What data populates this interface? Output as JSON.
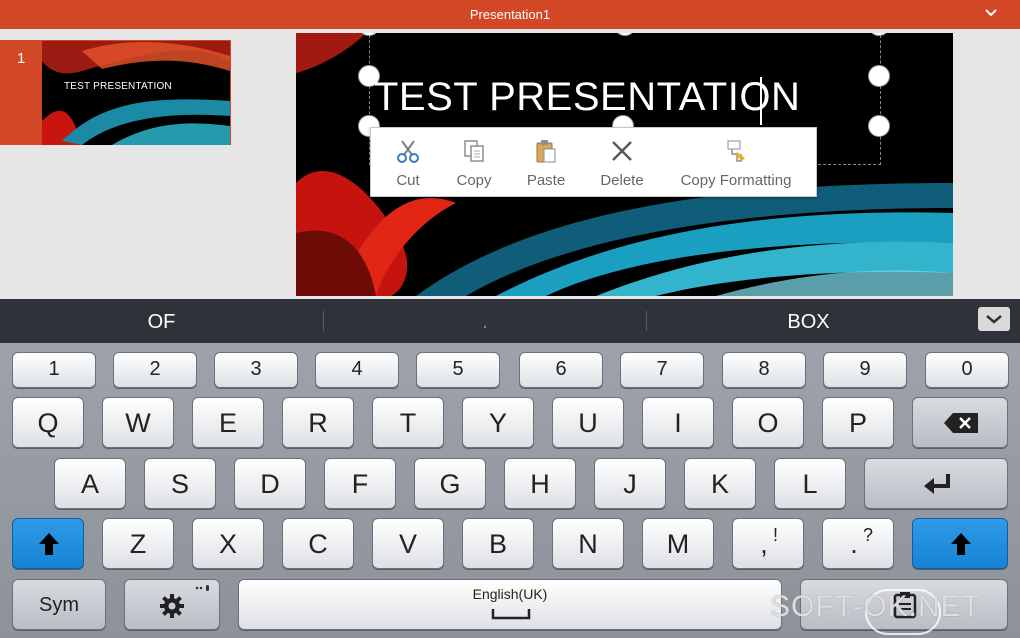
{
  "titlebar": {
    "title": "Presentation1"
  },
  "slides_panel": {
    "slide_number": "1",
    "thumb_title": "TEST PRESENTATION"
  },
  "slide": {
    "title": "TEST PRESENTATION"
  },
  "context_menu": {
    "items": [
      {
        "label": "Cut",
        "icon": "scissors-icon"
      },
      {
        "label": "Copy",
        "icon": "copy-icon"
      },
      {
        "label": "Paste",
        "icon": "paste-icon"
      },
      {
        "label": "Delete",
        "icon": "delete-x-icon"
      },
      {
        "label": "Copy Formatting",
        "icon": "format-painter-icon"
      }
    ]
  },
  "suggestions": {
    "left": "OF",
    "middle": ".",
    "right": "BOX"
  },
  "keyboard": {
    "numbers": [
      "1",
      "2",
      "3",
      "4",
      "5",
      "6",
      "7",
      "8",
      "9",
      "0"
    ],
    "row1": [
      "Q",
      "W",
      "E",
      "R",
      "T",
      "Y",
      "U",
      "I",
      "O",
      "P"
    ],
    "row2": [
      "A",
      "S",
      "D",
      "F",
      "G",
      "H",
      "J",
      "K",
      "L"
    ],
    "row3": [
      "Z",
      "X",
      "C",
      "V",
      "B",
      "N",
      "M"
    ],
    "comma": ",",
    "comma_alt": "!",
    "period": ".",
    "period_alt": "?",
    "sym": "Sym",
    "space": "English(UK)"
  },
  "watermark": {
    "text": "SOFT-OK.NET"
  },
  "colors": {
    "accent": "#d24726",
    "shift_blue": "#1683d4"
  }
}
